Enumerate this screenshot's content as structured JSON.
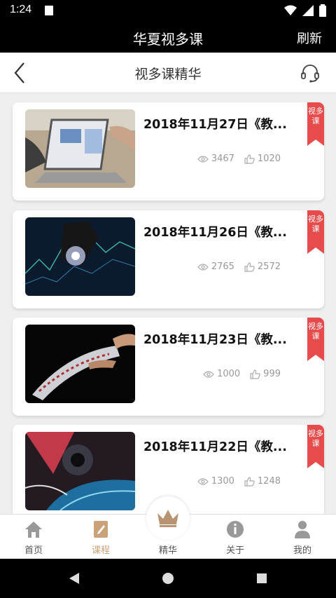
{
  "status": {
    "time": "1:24"
  },
  "app": {
    "title": "华夏视多课",
    "refresh_label": "刷新"
  },
  "header": {
    "title": "视多课精华"
  },
  "courses": [
    {
      "title": "2018年11月27日《教...",
      "views": "3467",
      "likes": "1020",
      "tag": "视多课"
    },
    {
      "title": "2018年11月26日《教...",
      "views": "2765",
      "likes": "2572",
      "tag": "视多课"
    },
    {
      "title": "2018年11月23日《教...",
      "views": "1000",
      "likes": "999",
      "tag": "视多课"
    },
    {
      "title": "2018年11月22日《教...",
      "views": "1300",
      "likes": "1248",
      "tag": "视多课"
    }
  ],
  "tabs": [
    {
      "label": "首页",
      "icon": "home-icon"
    },
    {
      "label": "课程",
      "icon": "course-icon"
    },
    {
      "label": "精华",
      "icon": "crown-icon"
    },
    {
      "label": "关于",
      "icon": "info-icon"
    },
    {
      "label": "我的",
      "icon": "user-icon"
    }
  ],
  "colors": {
    "accent": "#c9a27a",
    "ribbon": "#e84b4b",
    "bar": "#000000"
  }
}
